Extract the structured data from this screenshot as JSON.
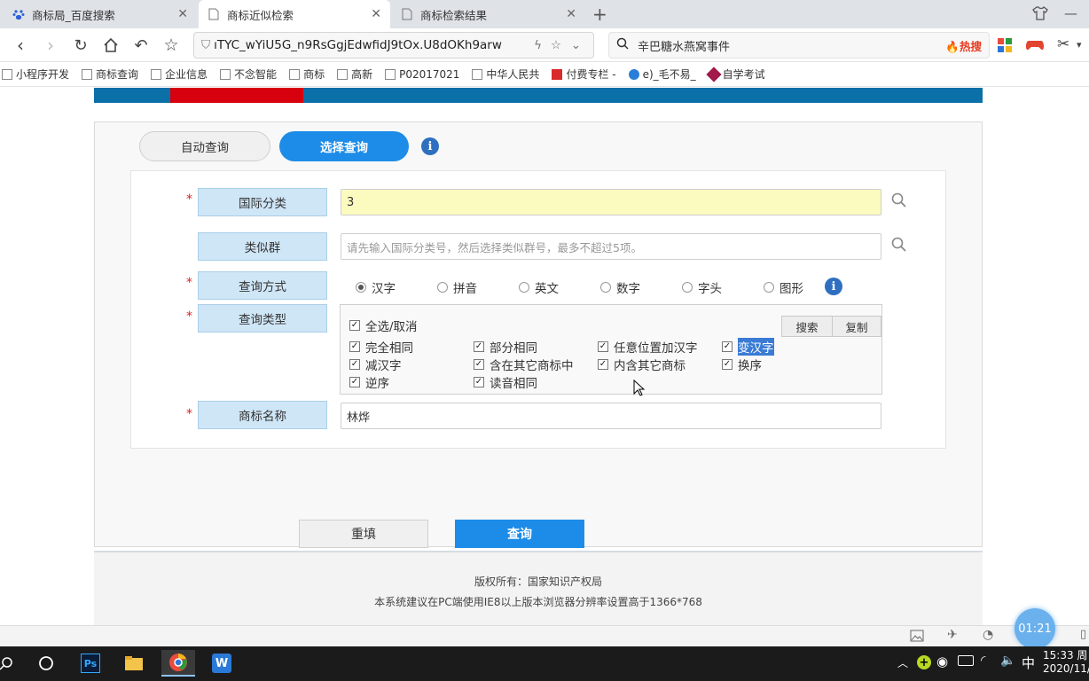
{
  "colors": {
    "nav_blue": "#0b6fa8",
    "nav_red": "#d6000f",
    "primary": "#1d8ce8",
    "label_bg": "#cfe6f7",
    "highlight": "#fbfbbf"
  },
  "tabs": [
    {
      "label": "商标局_百度搜索",
      "icon": "baidu-paw-icon"
    },
    {
      "label": "商标近似检索",
      "icon": "page-icon"
    },
    {
      "label": "商标检索结果",
      "icon": "page-icon"
    }
  ],
  "address": {
    "url": "ıTYC_wYiU5G_n9RsGgjEdwfidJ9tOx.U8dOKh9arw",
    "search_text": "辛巴糖水燕窝事件",
    "hot_label": "热搜"
  },
  "bookmarks": [
    "小程序开发",
    "商标查询",
    "企业信息",
    "不念智能",
    "商标",
    "高新",
    "P02017021",
    "中华人民共",
    "付费专栏 -",
    "e)_毛不易_",
    "自学考试"
  ],
  "form": {
    "mode_auto": "自动查询",
    "mode_select": "选择查询",
    "intl_class_label": "国际分类",
    "intl_class_value": "3",
    "similar_group_label": "类似群",
    "similar_group_placeholder": "请先输入国际分类号，然后选择类似群号，最多不超过5项。",
    "query_method_label": "查询方式",
    "methods": [
      "汉字",
      "拼音",
      "英文",
      "数字",
      "字头",
      "图形"
    ],
    "selected_method": "汉字",
    "query_type_label": "查询类型",
    "select_all": "全选/取消",
    "search_btn": "搜索",
    "copy_btn": "复制",
    "types": [
      "完全相同",
      "部分相同",
      "任意位置加汉字",
      "变汉字",
      "减汉字",
      "含在其它商标中",
      "内含其它商标",
      "换序",
      "逆序",
      "读音相同"
    ],
    "name_label": "商标名称",
    "name_value": "林烨",
    "reset_btn": "重填",
    "query_btn": "查询"
  },
  "footer": {
    "line1": "版权所有：国家知识产权局",
    "line2": "本系统建议在PC端使用IE8以上版本浏览器分辨率设置高于1366*768"
  },
  "timer": "01:21",
  "clock": {
    "time": "15:33 周",
    "date": "2020/11/"
  },
  "ime": "中"
}
